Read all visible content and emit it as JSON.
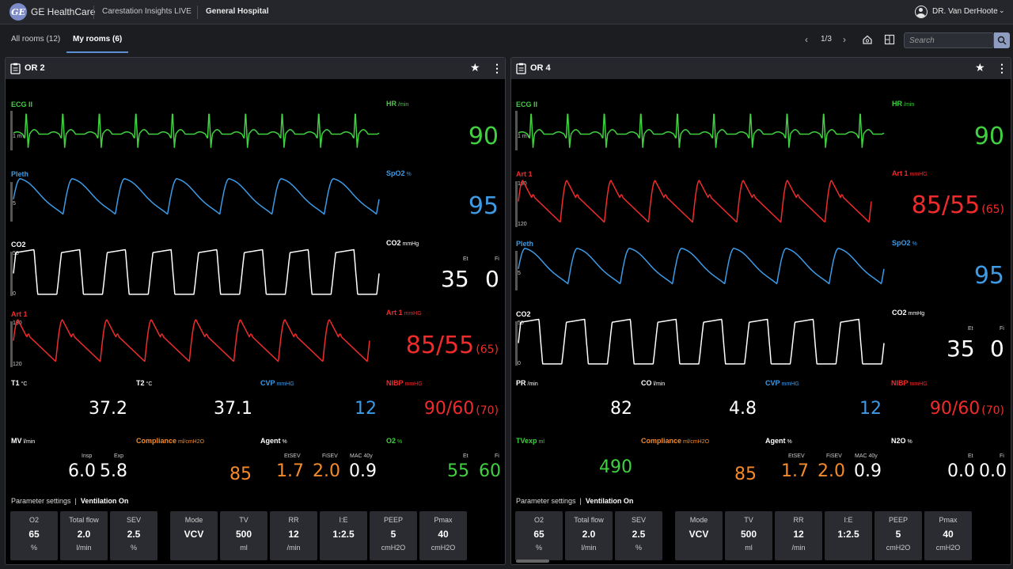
{
  "topbar": {
    "brand": "GE HealthCare",
    "logo_text": "GE",
    "app_name": "Carestation Insights LIVE",
    "hospital": "General Hospital",
    "user": "DR. Van DerHoote"
  },
  "tabs": [
    {
      "label": "All rooms (12)",
      "active": false
    },
    {
      "label": "My rooms (6)",
      "active": true
    }
  ],
  "pager": {
    "text": "1/3"
  },
  "search": {
    "placeholder": "Search"
  },
  "panels": [
    {
      "room": "OR 2",
      "waves": [
        {
          "label": "ECG II",
          "scale": [
            "1 mV"
          ]
        },
        {
          "label": "Pleth",
          "scale": [
            "5"
          ]
        },
        {
          "label": "CO2",
          "scale": [
            "50",
            "0"
          ]
        },
        {
          "label": "Art 1",
          "scale": [
            "180",
            "120"
          ]
        }
      ],
      "params": {
        "hr": {
          "label": "HR",
          "unit": "/min",
          "value": "90"
        },
        "spo2": {
          "label": "SpO2",
          "unit": "%",
          "value": "95"
        },
        "co2": {
          "label": "CO2",
          "unit": "mmHg",
          "et_label": "Et",
          "fi_label": "Fi",
          "et": "35",
          "fi": "0"
        },
        "art1": {
          "label": "Art 1",
          "unit": "mmHG",
          "value": "85/55",
          "mean": "(65)"
        }
      },
      "row1": {
        "t1": {
          "label": "T1",
          "unit": "°C",
          "value": "37.2"
        },
        "t2": {
          "label": "T2",
          "unit": "°C",
          "value": "37.1"
        },
        "cvp": {
          "label": "CVP",
          "unit": "mmHG",
          "value": "12"
        },
        "nibp": {
          "label": "NIBP",
          "unit": "mmHG",
          "value": "90/60",
          "mean": "(70)"
        }
      },
      "row2": {
        "mv": {
          "label": "MV",
          "unit": "l/min",
          "insp_label": "Insp",
          "exp_label": "Exp",
          "insp": "6.0",
          "exp": "5.8"
        },
        "compliance": {
          "label": "Compliance",
          "unit": "ml/cmH2O",
          "value": "85"
        },
        "agent": {
          "label": "Agent",
          "unit": "%",
          "l1": "EtSEV",
          "l2": "FiSEV",
          "l3": "MAC 40y",
          "v1": "1.7",
          "v2": "2.0",
          "v3": "0.9"
        },
        "o2": {
          "label": "O2",
          "unit": "%",
          "et_label": "Et",
          "fi_label": "Fi",
          "et": "55",
          "fi": "60"
        }
      },
      "settings_label": "Parameter settings",
      "settings_mode": "Ventilation On",
      "gas_settings": [
        {
          "label": "O2",
          "value": "65",
          "unit": "%"
        },
        {
          "label": "Total flow",
          "value": "2.0",
          "unit": "l/min"
        },
        {
          "label": "SEV",
          "value": "2.5",
          "unit": "%"
        }
      ],
      "vent_settings": [
        {
          "label": "Mode",
          "value": "VCV",
          "unit": ""
        },
        {
          "label": "TV",
          "value": "500",
          "unit": "ml"
        },
        {
          "label": "RR",
          "value": "12",
          "unit": "/min"
        },
        {
          "label": "I:E",
          "value": "1:2.5",
          "unit": ""
        },
        {
          "label": "PEEP",
          "value": "5",
          "unit": "cmH2O"
        },
        {
          "label": "Pmax",
          "value": "40",
          "unit": "cmH2O"
        }
      ]
    },
    {
      "room": "OR 4",
      "waves": [
        {
          "label": "ECG II",
          "scale": [
            "1 mV"
          ]
        },
        {
          "label": "Art 1",
          "scale": [
            "180",
            "120"
          ]
        },
        {
          "label": "Pleth",
          "scale": [
            "5"
          ]
        },
        {
          "label": "CO2",
          "scale": [
            "50",
            "0"
          ]
        }
      ],
      "params": {
        "hr": {
          "label": "HR",
          "unit": "/min",
          "value": "90"
        },
        "art1": {
          "label": "Art 1",
          "unit": "mmHG",
          "value": "85/55",
          "mean": "(65)"
        },
        "spo2": {
          "label": "SpO2",
          "unit": "%",
          "value": "95"
        },
        "co2": {
          "label": "CO2",
          "unit": "mmHg",
          "et_label": "Et",
          "fi_label": "Fi",
          "et": "35",
          "fi": "0"
        }
      },
      "row1": {
        "pr": {
          "label": "PR",
          "unit": "/min",
          "value": "82"
        },
        "co": {
          "label": "CO",
          "unit": "l/min",
          "value": "4.8"
        },
        "cvp": {
          "label": "CVP",
          "unit": "mmHG",
          "value": "12"
        },
        "nibp": {
          "label": "NIBP",
          "unit": "mmHG",
          "value": "90/60",
          "mean": "(70)"
        }
      },
      "row2": {
        "tvexp": {
          "label": "TVexp",
          "unit": "ml",
          "value": "490"
        },
        "compliance": {
          "label": "Compliance",
          "unit": "ml/cmH2O",
          "value": "85"
        },
        "agent": {
          "label": "Agent",
          "unit": "%",
          "l1": "EtSEV",
          "l2": "FiSEV",
          "l3": "MAC 40y",
          "v1": "1.7",
          "v2": "2.0",
          "v3": "0.9"
        },
        "n2o": {
          "label": "N2O",
          "unit": "%",
          "et_label": "Et",
          "fi_label": "Fi",
          "et": "0.0",
          "fi": "0.0"
        }
      },
      "settings_label": "Parameter settings",
      "settings_mode": "Ventilation On",
      "gas_settings": [
        {
          "label": "O2",
          "value": "65",
          "unit": "%"
        },
        {
          "label": "Total flow",
          "value": "2.0",
          "unit": "l/min"
        },
        {
          "label": "SEV",
          "value": "2.5",
          "unit": "%"
        }
      ],
      "vent_settings": [
        {
          "label": "Mode",
          "value": "VCV",
          "unit": ""
        },
        {
          "label": "TV",
          "value": "500",
          "unit": "ml"
        },
        {
          "label": "RR",
          "value": "12",
          "unit": "/min"
        },
        {
          "label": "I:E",
          "value": "1:2.5",
          "unit": ""
        },
        {
          "label": "PEEP",
          "value": "5",
          "unit": "cmH2O"
        },
        {
          "label": "Pmax",
          "value": "40",
          "unit": "cmH2O"
        }
      ]
    }
  ],
  "colors": {
    "ecg": "#3fd13f",
    "pleth": "#3d9be6",
    "co2": "#ffffff",
    "art": "#ef2b2b",
    "compliance": "#f58a2a",
    "accent": "#5b8fd6"
  },
  "icons": [
    "user-icon",
    "chevron-down-icon",
    "chevron-left-icon",
    "chevron-right-icon",
    "home-icon",
    "layout-icon",
    "search-icon",
    "clipboard-icon",
    "star-icon",
    "kebab-menu-icon"
  ]
}
